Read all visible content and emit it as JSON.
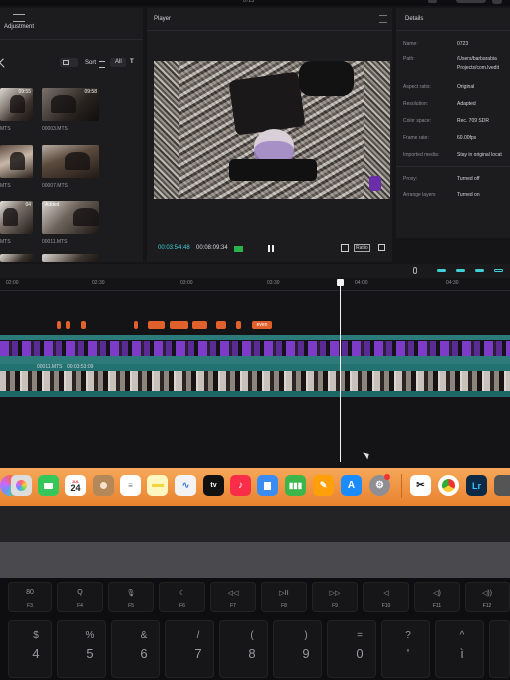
{
  "top_title": "0723",
  "left_panel": {
    "title": "Adjustment",
    "sort_label": "Sort",
    "all_label": "All",
    "clips": [
      {
        "duration": "09:55",
        "name": "MTS"
      },
      {
        "duration": "09:58",
        "name": "00003.MTS"
      },
      {
        "duration": "",
        "name": "MTS"
      },
      {
        "duration": "",
        "name": "00007.MTS"
      },
      {
        "duration": "04",
        "name": "MTS"
      },
      {
        "duration": "Added",
        "name": "00011.MTS"
      }
    ]
  },
  "player": {
    "title": "Player",
    "current_time": "00:03:54:48",
    "total_time": "00:08:09:34",
    "ratio_label": "Ratio"
  },
  "details": {
    "title": "Details",
    "rows": [
      {
        "label": "Name:",
        "value": "0723"
      },
      {
        "label": "Path:",
        "value": "/Users/barbarabia"
      },
      {
        "label": "",
        "value": "Projects/com.lvedit"
      },
      {
        "label": "Aspect ratio:",
        "value": "Original"
      },
      {
        "label": "Resolution:",
        "value": "Adapted"
      },
      {
        "label": "Color space:",
        "value": "Rec. 709 SDR"
      },
      {
        "label": "Frame rate:",
        "value": "60.00fps"
      },
      {
        "label": "Imported media:",
        "value": "Stay in original locat"
      },
      {
        "label": "Proxy:",
        "value": "Turned off"
      },
      {
        "label": "Arrange layers",
        "value": "Turned on"
      }
    ]
  },
  "timeline": {
    "ruler": [
      "02:00",
      "02:30",
      "03:00",
      "03:30",
      "04:00",
      "04:30"
    ],
    "event_chip": "even",
    "clip_label": "00011.MTS",
    "clip_time": "00:03:53:09"
  },
  "dock": {
    "calendar_month": "JUL",
    "calendar_day": "24",
    "tv_label": "tv"
  },
  "keyboard": {
    "fkeys": [
      "F3",
      "F4",
      "F5",
      "F6",
      "F7",
      "F8",
      "F9",
      "F10",
      "F11",
      "F12"
    ],
    "fkey_icons": [
      "80",
      "Q",
      "🎙",
      "☾",
      "◁◁",
      "▷II",
      "▷▷",
      "◁",
      "◁)",
      "◁))"
    ],
    "num_top": [
      "$",
      "%",
      "&",
      "/",
      "(",
      ")",
      "=",
      "?",
      "^"
    ],
    "num_bottom": [
      "4",
      "5",
      "6",
      "7",
      "8",
      "9",
      "0",
      "'",
      "ì"
    ]
  },
  "colors": {
    "accent_cyan": "#3fd0d6",
    "timeline_purple": "#7d3cc8",
    "event_orange": "#e0612c",
    "dock_orange": "#ef9440"
  }
}
